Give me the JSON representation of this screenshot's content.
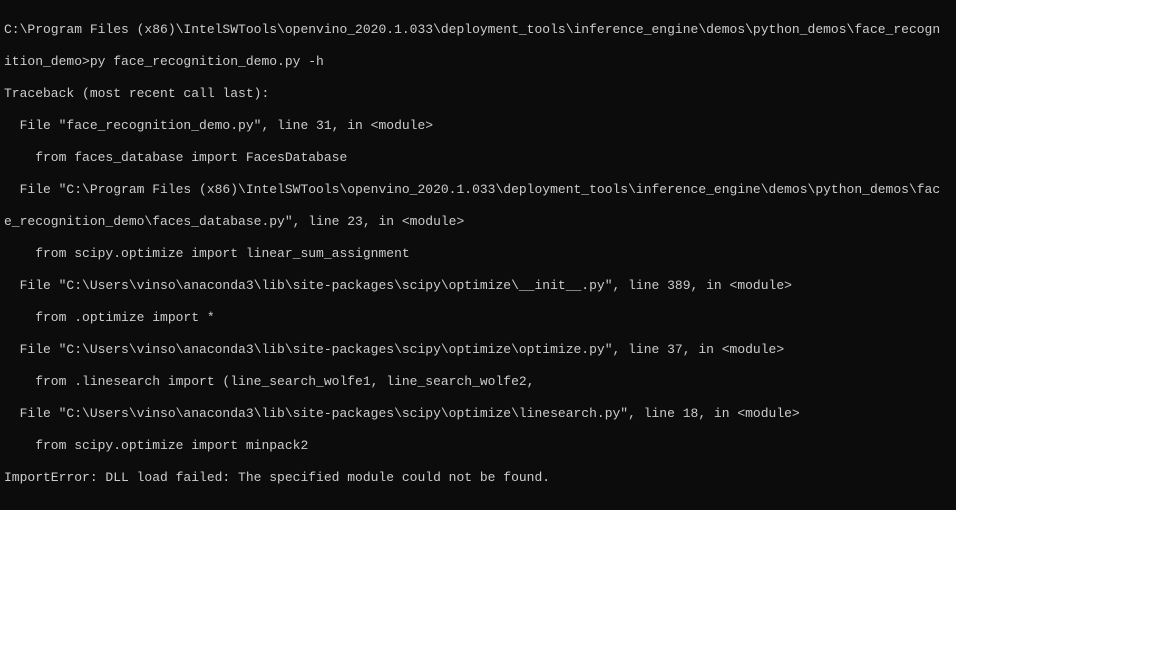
{
  "terminal": {
    "lines": [
      "C:\\Program Files (x86)\\IntelSWTools\\openvino_2020.1.033\\deployment_tools\\inference_engine\\demos\\python_demos\\face_recogn",
      "ition_demo>py face_recognition_demo.py -h",
      "Traceback (most recent call last):",
      "  File \"face_recognition_demo.py\", line 31, in <module>",
      "    from faces_database import FacesDatabase",
      "  File \"C:\\Program Files (x86)\\IntelSWTools\\openvino_2020.1.033\\deployment_tools\\inference_engine\\demos\\python_demos\\fac",
      "e_recognition_demo\\faces_database.py\", line 23, in <module>",
      "    from scipy.optimize import linear_sum_assignment",
      "  File \"C:\\Users\\vinso\\anaconda3\\lib\\site-packages\\scipy\\optimize\\__init__.py\", line 389, in <module>",
      "    from .optimize import *",
      "  File \"C:\\Users\\vinso\\anaconda3\\lib\\site-packages\\scipy\\optimize\\optimize.py\", line 37, in <module>",
      "    from .linesearch import (line_search_wolfe1, line_search_wolfe2,",
      "  File \"C:\\Users\\vinso\\anaconda3\\lib\\site-packages\\scipy\\optimize\\linesearch.py\", line 18, in <module>",
      "    from scipy.optimize import minpack2",
      "ImportError: DLL load failed: The specified module could not be found."
    ]
  },
  "stray": {
    "dot": "."
  }
}
